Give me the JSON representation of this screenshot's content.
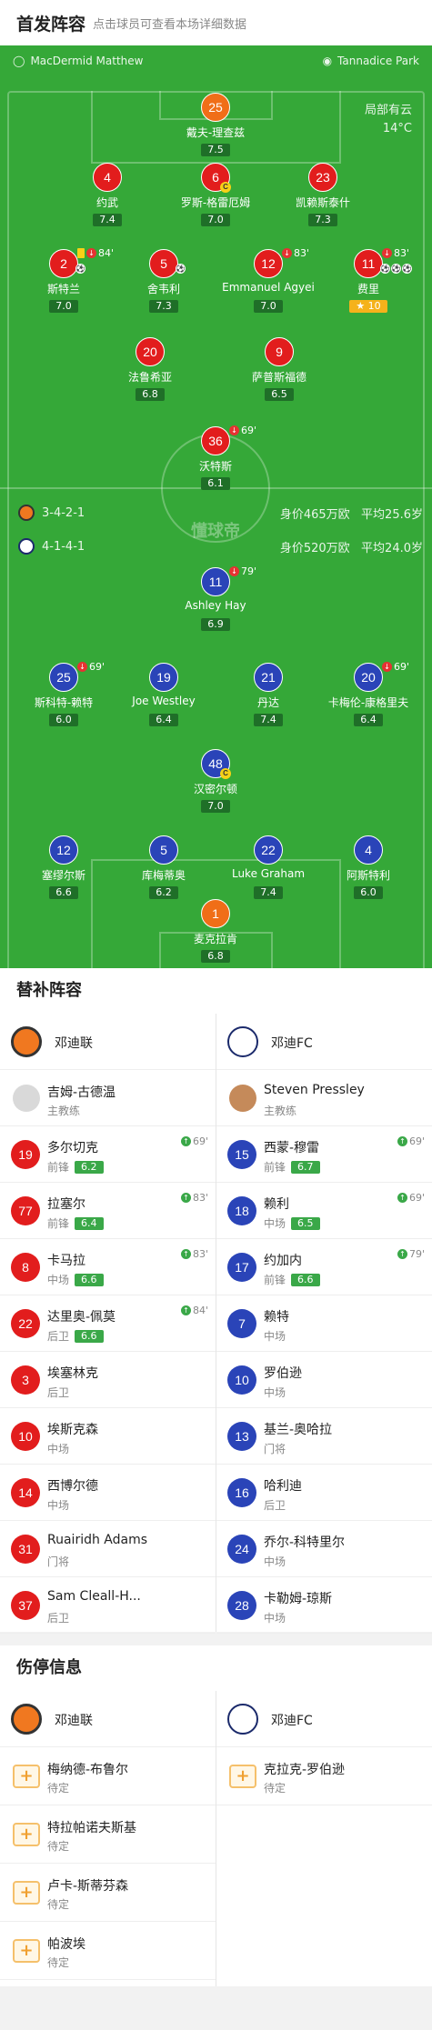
{
  "header": {
    "title": "首发阵容",
    "hint": "点击球员可查看本场详细数据"
  },
  "pitch": {
    "home_venue": "MacDermid Matthew",
    "away_venue": "Tannadice Park",
    "weather": "局部有云",
    "temp": "14°C",
    "watermark": "懂球帝",
    "home_formation": "3-4-2-1",
    "home_value": "身价465万欧",
    "home_age": "平均25.6岁",
    "away_formation": "4-1-4-1",
    "away_value": "身价520万欧",
    "away_age": "平均24.0岁"
  },
  "home_players": [
    {
      "num": "25",
      "name": "戴夫-理查兹",
      "rating": "7.5",
      "kind": "o"
    },
    {
      "num": "4",
      "name": "约武",
      "rating": "7.4",
      "kind": "r"
    },
    {
      "num": "6",
      "name": "罗斯-格雷厄姆",
      "rating": "7.0",
      "kind": "r",
      "captain": "C"
    },
    {
      "num": "23",
      "name": "凯赖斯泰什",
      "rating": "7.3",
      "kind": "r"
    },
    {
      "num": "2",
      "name": "斯特兰",
      "rating": "7.0",
      "kind": "r",
      "event": "84'",
      "yellow": true,
      "ball": true
    },
    {
      "num": "5",
      "name": "舍韦利",
      "rating": "7.3",
      "kind": "r",
      "ball": true
    },
    {
      "num": "12",
      "name": "Emmanuel Agyei",
      "rating": "7.0",
      "kind": "r",
      "event": "83'"
    },
    {
      "num": "11",
      "name": "费里",
      "rating": "10",
      "kind": "r",
      "event": "83'",
      "star": true,
      "balls": 3
    },
    {
      "num": "20",
      "name": "法鲁希亚",
      "rating": "6.8",
      "kind": "r"
    },
    {
      "num": "9",
      "name": "萨普斯福德",
      "rating": "6.5",
      "kind": "r"
    },
    {
      "num": "36",
      "name": "沃特斯",
      "rating": "6.1",
      "kind": "r",
      "event": "69'"
    }
  ],
  "away_players": [
    {
      "num": "11",
      "name": "Ashley Hay",
      "rating": "6.9",
      "kind": "b",
      "event": "79'"
    },
    {
      "num": "25",
      "name": "斯科特-赖特",
      "rating": "6.0",
      "kind": "b",
      "event": "69'"
    },
    {
      "num": "19",
      "name": "Joe Westley",
      "rating": "6.4",
      "kind": "b"
    },
    {
      "num": "21",
      "name": "丹达",
      "rating": "7.4",
      "kind": "b"
    },
    {
      "num": "20",
      "name": "卡梅伦-康格里夫",
      "rating": "6.4",
      "kind": "b",
      "event": "69'"
    },
    {
      "num": "48",
      "name": "汉密尔顿",
      "rating": "7.0",
      "kind": "b",
      "captain": "C"
    },
    {
      "num": "12",
      "name": "塞缪尔斯",
      "rating": "6.6",
      "kind": "b"
    },
    {
      "num": "5",
      "name": "库梅蒂奥",
      "rating": "6.2",
      "kind": "b"
    },
    {
      "num": "22",
      "name": "Luke Graham",
      "rating": "7.4",
      "kind": "b"
    },
    {
      "num": "4",
      "name": "阿斯特利",
      "rating": "6.0",
      "kind": "b"
    },
    {
      "num": "1",
      "name": "麦克拉肯",
      "rating": "6.8",
      "kind": "o"
    }
  ],
  "subs_title": "替补阵容",
  "home_team": "邓迪联",
  "away_team": "邓迪FC",
  "home_coach": {
    "name": "吉姆-古德温",
    "role": "主教练"
  },
  "away_coach": {
    "name": "Steven Pressley",
    "role": "主教练"
  },
  "home_subs": [
    {
      "num": "19",
      "name": "多尔切克",
      "pos": "前锋",
      "rating": "6.2",
      "sub": "69'"
    },
    {
      "num": "77",
      "name": "拉塞尔",
      "pos": "前锋",
      "rating": "6.4",
      "sub": "83'"
    },
    {
      "num": "8",
      "name": "卡马拉",
      "pos": "中场",
      "rating": "6.6",
      "sub": "83'"
    },
    {
      "num": "22",
      "name": "达里奥-佩莫",
      "pos": "后卫",
      "rating": "6.6",
      "sub": "84'"
    },
    {
      "num": "3",
      "name": "埃塞林克",
      "pos": "后卫"
    },
    {
      "num": "10",
      "name": "埃斯克森",
      "pos": "中场"
    },
    {
      "num": "14",
      "name": "西博尔德",
      "pos": "中场"
    },
    {
      "num": "31",
      "name": "Ruairidh Adams",
      "pos": "门将"
    },
    {
      "num": "37",
      "name": "Sam Cleall-H...",
      "pos": "后卫"
    }
  ],
  "away_subs": [
    {
      "num": "15",
      "name": "西蒙-穆雷",
      "pos": "前锋",
      "rating": "6.7",
      "sub": "69'"
    },
    {
      "num": "18",
      "name": "赖利",
      "pos": "中场",
      "rating": "6.5",
      "sub": "69'"
    },
    {
      "num": "17",
      "name": "约加内",
      "pos": "前锋",
      "rating": "6.6",
      "sub": "79'"
    },
    {
      "num": "7",
      "name": "赖特",
      "pos": "中场"
    },
    {
      "num": "10",
      "name": "罗伯逊",
      "pos": "中场"
    },
    {
      "num": "13",
      "name": "基兰-奥哈拉",
      "pos": "门将"
    },
    {
      "num": "16",
      "name": "哈利迪",
      "pos": "后卫"
    },
    {
      "num": "24",
      "name": "乔尔-科特里尔",
      "pos": "中场"
    },
    {
      "num": "28",
      "name": "卡勒姆-琼斯",
      "pos": "中场"
    }
  ],
  "injury_title": "伤停信息",
  "home_injuries": [
    {
      "name": "梅纳德-布鲁尔",
      "status": "待定"
    },
    {
      "name": "特拉帕诺夫斯基",
      "status": "待定"
    },
    {
      "name": "卢卡-斯蒂芬森",
      "status": "待定"
    },
    {
      "name": "帕波埃",
      "status": "待定"
    }
  ],
  "away_injuries": [
    {
      "name": "克拉克-罗伯逊",
      "status": "待定"
    }
  ]
}
